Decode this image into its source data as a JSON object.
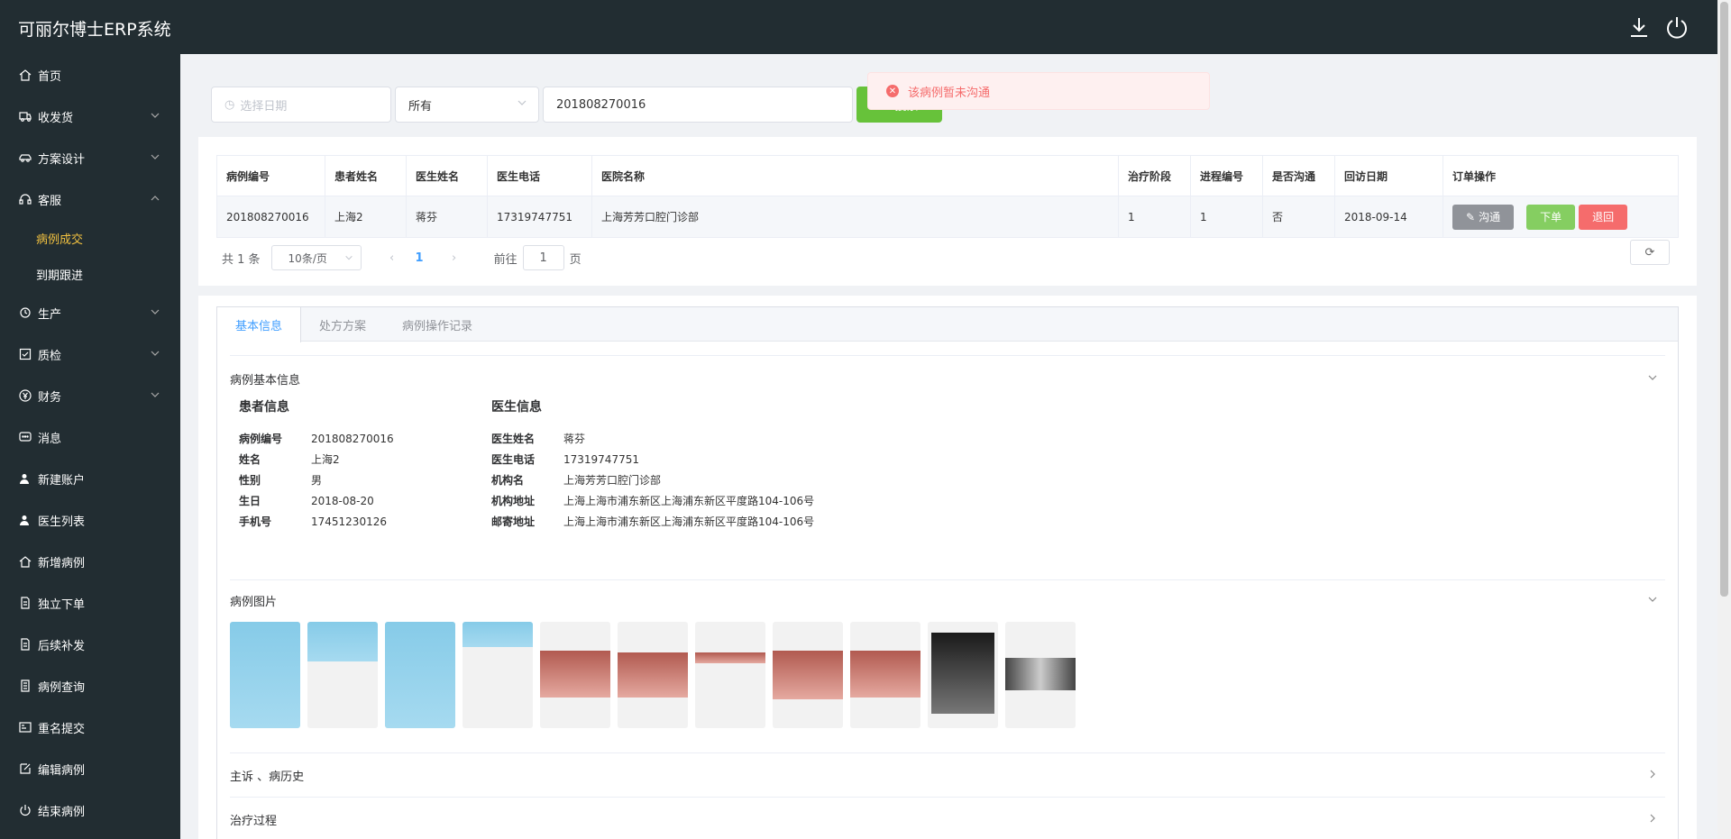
{
  "app": {
    "title": "可丽尔博士ERP系统"
  },
  "sidebar": {
    "items": [
      {
        "label": "首页",
        "icon": "home-icon"
      },
      {
        "label": "收发货",
        "icon": "truck-icon",
        "expandable": true
      },
      {
        "label": "方案设计",
        "icon": "car-icon",
        "expandable": true
      },
      {
        "label": "客服",
        "icon": "headset-icon",
        "expandable": true,
        "expanded": true
      },
      {
        "label": "病例成交",
        "sub": true,
        "active": true
      },
      {
        "label": "到期跟进",
        "sub": true
      },
      {
        "label": "生产",
        "icon": "cycle-icon",
        "expandable": true
      },
      {
        "label": "质检",
        "icon": "checkbox-icon",
        "expandable": true
      },
      {
        "label": "财务",
        "icon": "yen-icon",
        "expandable": true
      },
      {
        "label": "消息",
        "icon": "chat-icon"
      },
      {
        "label": "新建账户",
        "icon": "user-add-icon"
      },
      {
        "label": "医生列表",
        "icon": "user-list-icon"
      },
      {
        "label": "新增病例",
        "icon": "home-add-icon"
      },
      {
        "label": "独立下单",
        "icon": "doc-order-icon"
      },
      {
        "label": "后续补发",
        "icon": "doc-resend-icon"
      },
      {
        "label": "病例查询",
        "icon": "doc-search-icon"
      },
      {
        "label": "重名提交",
        "icon": "id-card-icon"
      },
      {
        "label": "编辑病例",
        "icon": "edit-icon"
      },
      {
        "label": "结束病例",
        "icon": "power-icon"
      }
    ]
  },
  "toast": {
    "message": "该病例暂未沟通"
  },
  "search": {
    "date_placeholder": "选择日期",
    "select_value": "所有",
    "keyword": "201808270016",
    "button": "搜索"
  },
  "table": {
    "headers": [
      "病例编号",
      "患者姓名",
      "医生姓名",
      "医生电话",
      "医院名称",
      "治疗阶段",
      "进程编号",
      "是否沟通",
      "回访日期",
      "订单操作"
    ],
    "rows": [
      [
        "201808270016",
        "上海2",
        "蒋芬",
        "17319747751",
        "上海芳芳口腔门诊部",
        "1",
        "1",
        "否",
        "2018-09-14"
      ]
    ],
    "actions": {
      "talk": "沟通",
      "order": "下单",
      "back": "退回"
    }
  },
  "pager": {
    "total": "共 1 条",
    "size": "10条/页",
    "page": "1",
    "goto_prefix": "前往",
    "goto_value": "1",
    "goto_suffix": "页"
  },
  "tabs": [
    "基本信息",
    "处方方案",
    "病例操作记录"
  ],
  "basic": {
    "section_title": "病例基本信息",
    "patient": {
      "title": "患者信息",
      "rows": [
        {
          "k": "病例编号",
          "v": "201808270016"
        },
        {
          "k": "姓名",
          "v": "上海2"
        },
        {
          "k": "性别",
          "v": "男"
        },
        {
          "k": "生日",
          "v": "2018-08-20"
        },
        {
          "k": "手机号",
          "v": "17451230126"
        }
      ]
    },
    "doctor": {
      "title": "医生信息",
      "rows": [
        {
          "k": "医生姓名",
          "v": "蒋芬"
        },
        {
          "k": "医生电话",
          "v": "17319747751"
        },
        {
          "k": "机构名",
          "v": "上海芳芳口腔门诊部"
        },
        {
          "k": "机构地址",
          "v": "上海上海市浦东新区上海浦东新区平度路104-106号"
        },
        {
          "k": "邮寄地址",
          "v": "上海上海市浦东新区上海浦东新区平度路104-106号"
        }
      ]
    }
  },
  "images": {
    "section_title": "病例图片"
  },
  "sections": {
    "complaint": "主诉 、病历史",
    "treatment": "治疗过程"
  }
}
